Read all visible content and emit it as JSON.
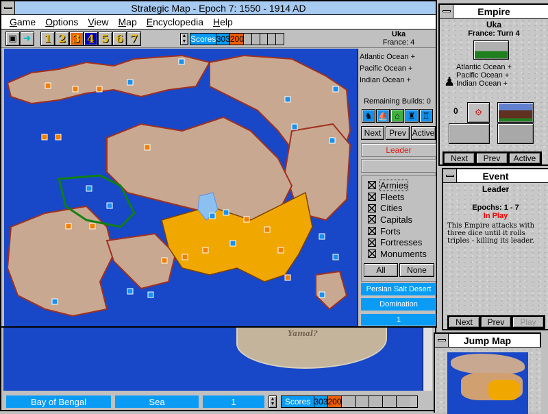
{
  "main_window": {
    "title": "Strategic Map - Epoch 7: 1550 - 1914 AD",
    "menu": [
      "Game",
      "Options",
      "View",
      "Map",
      "Encyclopedia",
      "Help"
    ],
    "toolbar": {
      "epochs": [
        "1",
        "2",
        "3",
        "4",
        "5",
        "6",
        "7"
      ],
      "active_epoch": "4",
      "highlight_epoch": "3",
      "scores_label": "Scores",
      "scores": [
        "303",
        "200"
      ],
      "score_colors": [
        "#0a9cf4",
        "#f06000"
      ],
      "empire_name": "Uka",
      "empire_turn": "France: 4"
    },
    "side_panel": {
      "seas": [
        "Atlantic Ocean +",
        "Pacific Ocean +",
        "Indian Ocean +"
      ],
      "remaining_builds": "Remaining Builds: 0",
      "build_icons": [
        "army-icon",
        "fleet-icon",
        "city-icon",
        "fort-icon",
        "fortress-icon"
      ],
      "nav": [
        "Next",
        "Prev",
        "Active"
      ],
      "leader": "Leader",
      "leader_value": "",
      "filters": [
        "Armies",
        "Fleets",
        "Cities",
        "Capitals",
        "Forts",
        "Fortresses",
        "Monuments"
      ],
      "all": "All",
      "none": "None",
      "territory": "Persian Salt Desert",
      "terrain": "Domination",
      "value": "1"
    }
  },
  "background_window": {
    "map_label": "Yamal?",
    "status": {
      "territory": "Bay of Bengal",
      "type": "Sea",
      "value": "1",
      "scores_label": "Scores",
      "scores": [
        "303",
        "200"
      ]
    }
  },
  "empire_panel": {
    "title": "Empire",
    "name": "Uka",
    "turn": "France: Turn 4",
    "seas": [
      "Atlantic Ocean +",
      "Pacific Ocean +",
      "Indian Ocean +"
    ],
    "count": "0",
    "nav": [
      "Next",
      "Prev",
      "Active"
    ]
  },
  "event_panel": {
    "title": "Event",
    "name": "Leader",
    "epochs": "Epochs: 1 - 7",
    "status": "In Play",
    "description": "This Empire attacks with three dice until it rolls triples - killing its leader.",
    "nav": [
      "Next",
      "Prev",
      "Play"
    ]
  },
  "jump_map": {
    "title": "Jump Map"
  }
}
